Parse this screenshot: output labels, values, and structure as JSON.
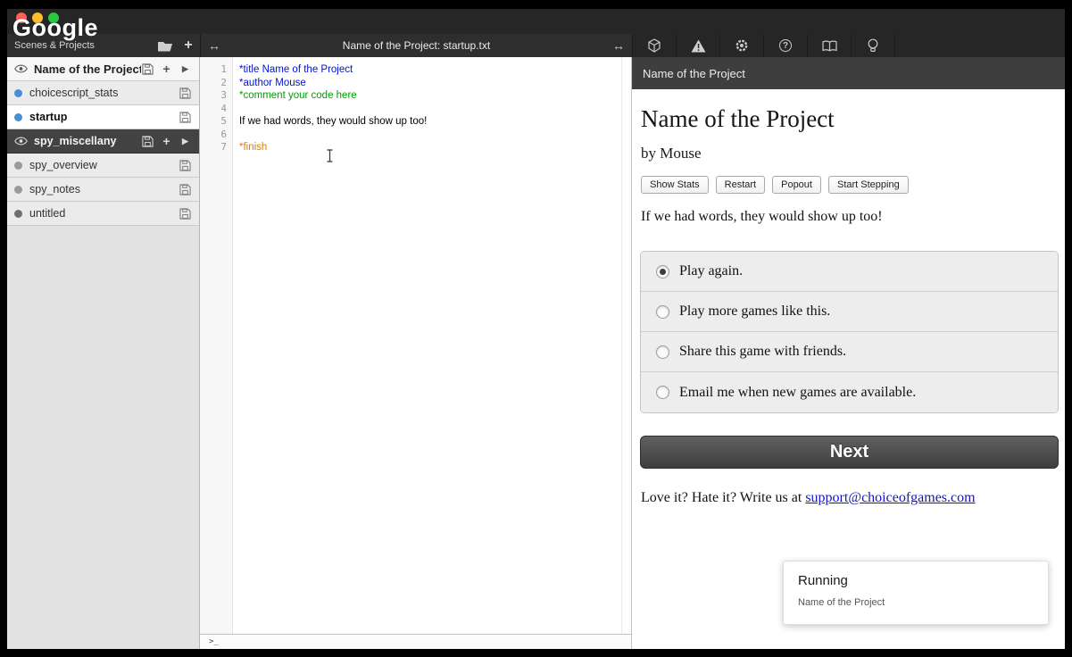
{
  "window": {
    "watermark": "Google"
  },
  "glyphs": {
    "plus": "+",
    "play": "▶",
    "hsplit": "↔",
    "help": "?"
  },
  "sidebar": {
    "header": "Scenes & Projects",
    "items": [
      {
        "label": "Name of the Project",
        "type": "project"
      },
      {
        "label": "choicescript_stats",
        "type": "scene",
        "dot": "blue"
      },
      {
        "label": "startup",
        "type": "scene",
        "dot": "blue",
        "selected": true
      },
      {
        "label": "spy_miscellany",
        "type": "project",
        "dark": true
      },
      {
        "label": "spy_overview",
        "type": "scene",
        "dot": "gray"
      },
      {
        "label": "spy_notes",
        "type": "scene",
        "dot": "gray"
      },
      {
        "label": "untitled",
        "type": "scene",
        "dot": "darkgray"
      }
    ]
  },
  "editor": {
    "title": "Name of the Project: startup.txt",
    "lines": [
      {
        "n": 1,
        "text": "*title Name of the Project",
        "style": "command"
      },
      {
        "n": 2,
        "text": "*author Mouse",
        "style": "command"
      },
      {
        "n": 3,
        "text": "*comment your code here",
        "style": "comment"
      },
      {
        "n": 4,
        "text": "",
        "style": "plain"
      },
      {
        "n": 5,
        "text": "If we had words, they would show up too!",
        "style": "plain"
      },
      {
        "n": 6,
        "text": "",
        "style": "plain"
      },
      {
        "n": 7,
        "text": "*finish",
        "style": "finish"
      }
    ],
    "console_prompt": ">_"
  },
  "preview": {
    "header": "Name of the Project",
    "game_title": "Name of the Project",
    "byline": "by Mouse",
    "toolbar_buttons": [
      "Show Stats",
      "Restart",
      "Popout",
      "Start Stepping"
    ],
    "paragraph": "If we had words, they would show up too!",
    "options": [
      {
        "label": "Play again.",
        "selected": true
      },
      {
        "label": "Play more games like this.",
        "selected": false
      },
      {
        "label": "Share this game with friends.",
        "selected": false
      },
      {
        "label": "Email me when new games are available.",
        "selected": false
      }
    ],
    "next_label": "Next",
    "footer_prefix": "Love it? Hate it? Write us at ",
    "footer_link": "support@choiceofgames.com",
    "notification": {
      "title": "Running",
      "subtitle": "Name of the Project"
    }
  },
  "colors": {
    "scene_dot_blue": "#4a8fd4",
    "scene_dot_gray": "#9a9a9a",
    "scene_dot_dark": "#6e6e6e",
    "code_command": "#0013d6",
    "code_comment": "#00a000",
    "code_finish": "#d97e00",
    "link": "#1515c8",
    "traffic_red": "#ff5f57",
    "traffic_yellow": "#febc2e",
    "traffic_green": "#28c841"
  }
}
